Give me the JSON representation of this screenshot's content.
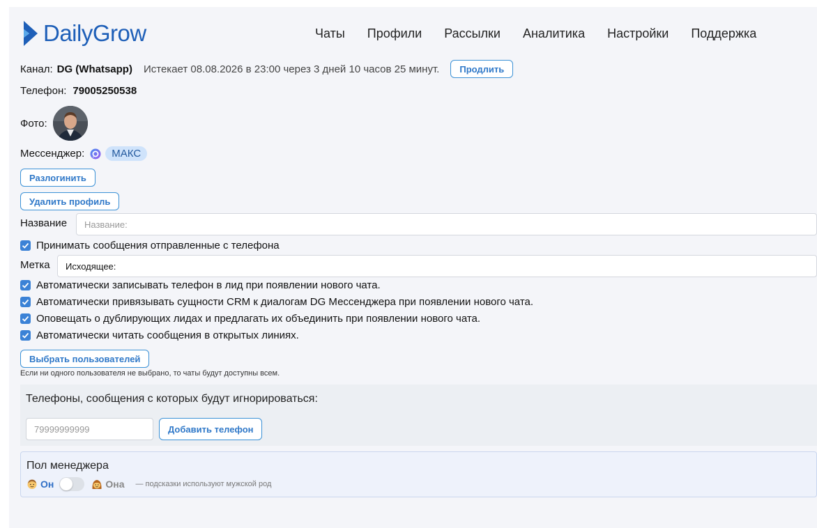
{
  "brand": {
    "name": "DailyGrow",
    "accent": "#1e5fb8"
  },
  "nav": [
    "Чаты",
    "Профили",
    "Рассылки",
    "Аналитика",
    "Настройки",
    "Поддержка"
  ],
  "channel": {
    "label": "Канал:",
    "name": "DG (Whatsapp)",
    "expires": "Истекает 08.08.2026 в 23:00 через 3 дней 10 часов 25 минут.",
    "extend_button": "Продлить"
  },
  "phone": {
    "label": "Телефон:",
    "value": "79005250538"
  },
  "photo": {
    "label": "Фото:"
  },
  "messenger": {
    "label": "Мессенджер:",
    "icon": "chat-bubble-icon",
    "badge": "МАКС"
  },
  "buttons": {
    "logout": "Разлогинить",
    "delete_profile": "Удалить профиль",
    "select_users": "Выбрать пользователей"
  },
  "name_field": {
    "label": "Название",
    "placeholder": "Название:",
    "value": ""
  },
  "checkbox_receive": {
    "label": "Принимать сообщения отправленные с телефона",
    "checked": true
  },
  "tag_field": {
    "label": "Метка",
    "value": "Исходящее:"
  },
  "checkboxes": [
    {
      "label": "Автоматически записывать телефон в лид при появлении нового чата.",
      "checked": true
    },
    {
      "label": "Автоматически привязывать сущности CRM к диалогам DG Мессенджера при появлении нового чата.",
      "checked": true
    },
    {
      "label": "Оповещать о дублирующих лидах и предлагать их объединить при появлении нового чата.",
      "checked": true
    },
    {
      "label": "Автоматически читать сообщения в открытых линиях.",
      "checked": true
    }
  ],
  "users_hint": "Если ни одного пользователя не выбрано, то чаты будут доступны всем.",
  "ignore": {
    "title": "Телефоны, сообщения с которых будут игнорироваться:",
    "placeholder": "79999999999",
    "add_button": "Добавить телефон"
  },
  "gender": {
    "title": "Пол менеджера",
    "on_label": "Он",
    "off_label": "Она",
    "note": "— подсказки используют мужской род",
    "female_selected": false
  }
}
